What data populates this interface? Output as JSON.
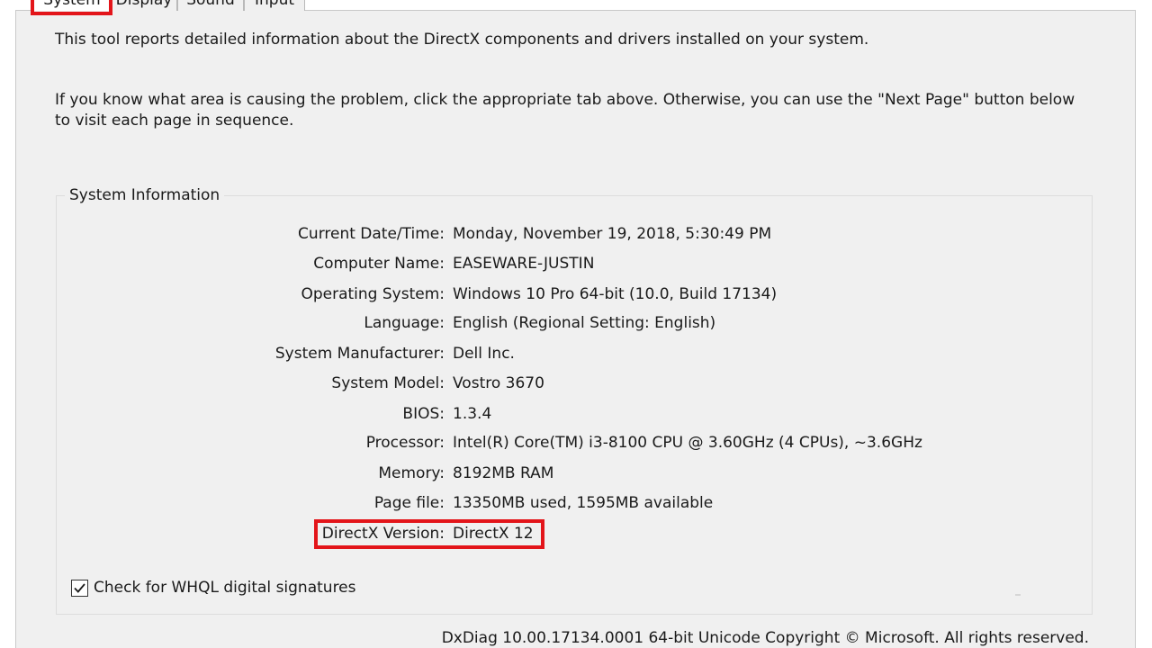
{
  "tabs": [
    {
      "label": "System",
      "active": true
    },
    {
      "label": "Display",
      "active": false
    },
    {
      "label": "Sound",
      "active": false
    },
    {
      "label": "Input",
      "active": false
    }
  ],
  "intro": {
    "line1": "This tool reports detailed information about the DirectX components and drivers installed on your system.",
    "line2": "If you know what area is causing the problem, click the appropriate tab above.  Otherwise, you can use the \"Next Page\" button below to visit each page in sequence."
  },
  "system_info": {
    "title": "System Information",
    "rows": [
      {
        "label": "Current Date/Time:",
        "value": "Monday, November 19, 2018, 5:30:49 PM"
      },
      {
        "label": "Computer Name:",
        "value": "EASEWARE-JUSTIN"
      },
      {
        "label": "Operating System:",
        "value": "Windows 10 Pro 64-bit (10.0, Build 17134)"
      },
      {
        "label": "Language:",
        "value": "English (Regional Setting: English)"
      },
      {
        "label": "System Manufacturer:",
        "value": "Dell Inc."
      },
      {
        "label": "System Model:",
        "value": "Vostro 3670"
      },
      {
        "label": "BIOS:",
        "value": "1.3.4"
      },
      {
        "label": "Processor:",
        "value": "Intel(R) Core(TM) i3-8100 CPU @ 3.60GHz (4 CPUs), ~3.6GHz"
      },
      {
        "label": "Memory:",
        "value": "8192MB RAM"
      },
      {
        "label": "Page file:",
        "value": "13350MB used, 1595MB available"
      },
      {
        "label": "DirectX Version:",
        "value": "DirectX 12"
      }
    ]
  },
  "whql": {
    "label": "Check for WHQL digital signatures",
    "checked": true
  },
  "footer": {
    "text": "DxDiag 10.00.17134.0001 64-bit Unicode  Copyright © Microsoft. All rights reserved."
  },
  "colors": {
    "highlight": "#e3151a",
    "panel_background": "#f0f0f0"
  },
  "icons": {
    "checkbox_mark": "checkmark-icon"
  }
}
